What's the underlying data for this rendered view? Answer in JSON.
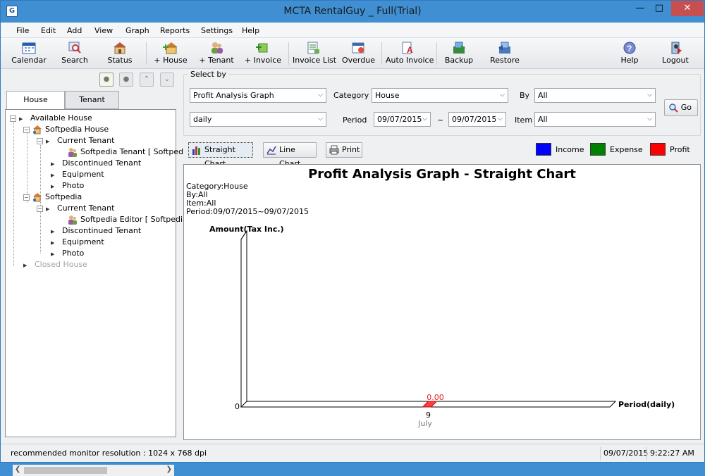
{
  "window": {
    "title": "MCTA RentalGuy _ Full(Trial)",
    "app_icon": "G"
  },
  "menu": [
    "File",
    "Edit",
    "Add",
    "View",
    "Graph",
    "Reports",
    "Settings",
    "Help"
  ],
  "toolbar": {
    "calendar": "Calendar",
    "search": "Search",
    "status": "Status",
    "add_house": "+ House",
    "add_tenant": "+ Tenant",
    "add_invoice": "+ Invoice",
    "invoice_list": "Invoice List",
    "overdue": "Overdue",
    "auto_invoice": "Auto Invoice",
    "backup": "Backup",
    "restore": "Restore",
    "help": "Help",
    "logout": "Logout"
  },
  "tabs": {
    "house": "House",
    "tenant": "Tenant"
  },
  "tree": {
    "available_house": "Available House",
    "house1": "Softpedia House",
    "current_tenant": "Current Tenant",
    "tenant1": "Softpedia Tenant [ Softped",
    "discontinued_tenant": "Discontinued Tenant",
    "equipment": "Equipment",
    "photo": "Photo",
    "house2": "Softpedia",
    "tenant2": "Softpedia Editor [ Softpedia",
    "closed_house": "Closed House"
  },
  "select": {
    "legend": "Select by",
    "graph_type": "Profit Analysis Graph",
    "category_label": "Category",
    "category": "House",
    "by_label": "By",
    "by": "All",
    "interval": "daily",
    "period_label": "Period",
    "period_from": "09/07/2015",
    "tilde": "~",
    "period_to": "09/07/2015",
    "item_label": "Item",
    "item": "All",
    "go": "Go"
  },
  "chart_buttons": {
    "straight": "Straight Chart",
    "line": "Line Chart",
    "print": "Print"
  },
  "legend": [
    {
      "label": "Income",
      "color": "#0000ff"
    },
    {
      "label": "Expense",
      "color": "#008000"
    },
    {
      "label": "Profit",
      "color": "#ff0000"
    }
  ],
  "chart_info": {
    "category": "Category:House",
    "by": "By:All",
    "item": "Item:All",
    "period": "Period:09/07/2015~09/07/2015"
  },
  "chart_data": {
    "type": "bar",
    "title": "Profit Analysis Graph - Straight Chart",
    "ylabel": "Amount(Tax Inc.)",
    "xlabel": "Period(daily)",
    "y_min_label": "0",
    "categories": [
      "9"
    ],
    "month_label": "July",
    "series": [
      {
        "name": "Profit",
        "values": [
          0.0
        ],
        "labels": [
          "0.00"
        ]
      }
    ]
  },
  "status": {
    "message": "recommended monitor resolution : 1024 x 768 dpi",
    "date": "09/07/2015",
    "time": "9:22:27 AM"
  }
}
